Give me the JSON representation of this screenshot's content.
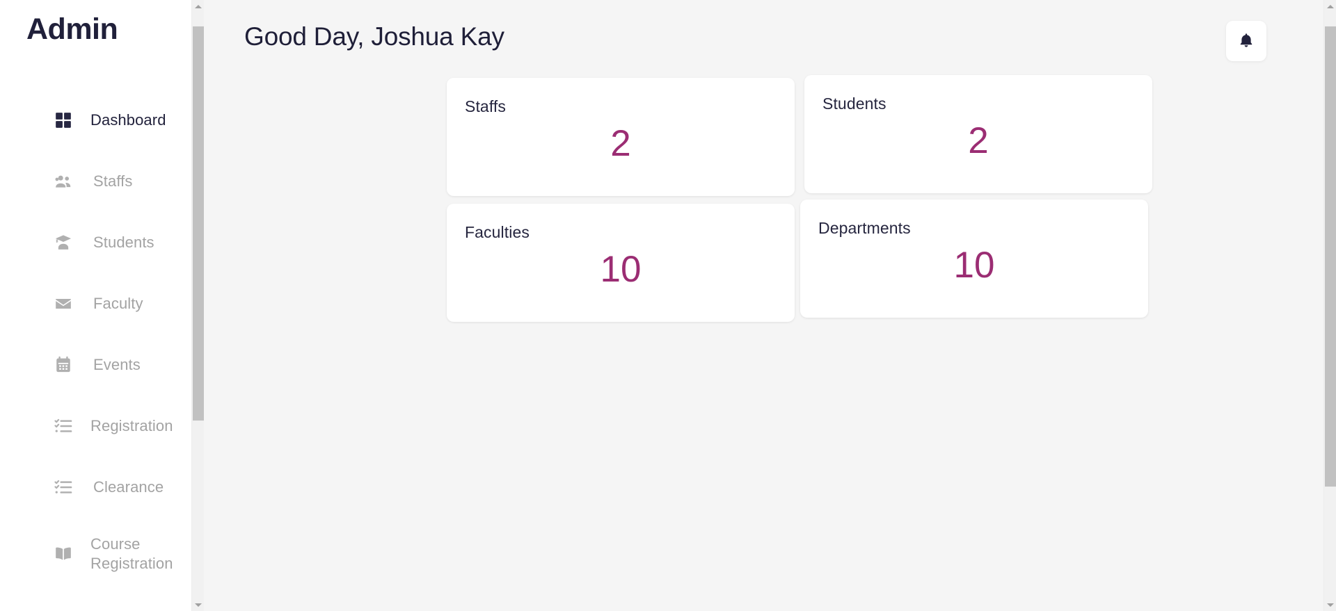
{
  "sidebar": {
    "brand": "Admin",
    "items": [
      {
        "label": "Dashboard",
        "icon": "grid-icon",
        "active": true
      },
      {
        "label": "Staffs",
        "icon": "people-icon",
        "active": false
      },
      {
        "label": "Students",
        "icon": "graduate-icon",
        "active": false
      },
      {
        "label": "Faculty",
        "icon": "envelope-icon",
        "active": false
      },
      {
        "label": "Events",
        "icon": "calendar-icon",
        "active": false
      },
      {
        "label": "Registration",
        "icon": "checklist-icon",
        "active": false
      },
      {
        "label": "Clearance",
        "icon": "checklist-icon",
        "active": false
      },
      {
        "label": "Course Registration",
        "icon": "book-icon",
        "active": false
      }
    ]
  },
  "header": {
    "greeting": "Good Day, Joshua Kay",
    "notification_icon": "bell-icon"
  },
  "main": {
    "cards": [
      {
        "label": "Staffs",
        "value": "2"
      },
      {
        "label": "Students",
        "value": "2"
      },
      {
        "label": "Faculties",
        "value": "10"
      },
      {
        "label": "Departments",
        "value": "10"
      }
    ]
  },
  "colors": {
    "accent_magenta": "#9b2d73",
    "navy": "#22223c",
    "muted_text": "#a3a3a3",
    "page_bg": "#f5f5f5"
  }
}
